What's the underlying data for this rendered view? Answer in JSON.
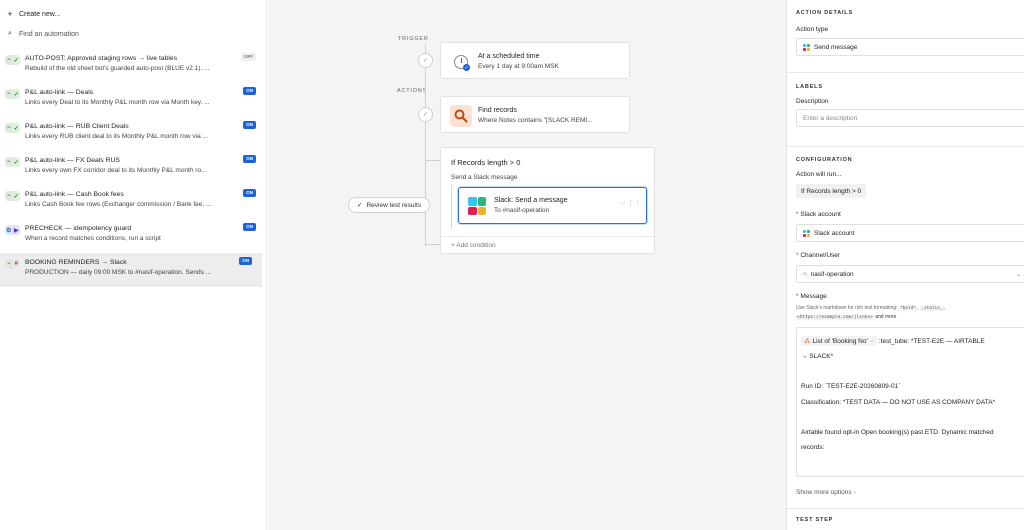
{
  "sidebar": {
    "create_label": "Create new...",
    "search_placeholder": "Find an automation",
    "items": [
      {
        "title": "AUTO-POST: Approved staging rows → live tables",
        "subtitle": "Rebuild of the old sheet bot's guarded auto-post (BLUE v2.1). ...",
        "badge": "OFF",
        "icons": [
          "minus",
          "check"
        ]
      },
      {
        "title": "P&L auto-link — Deals",
        "subtitle": "Links every Deal to its Monthly P&L month row via Month key. ...",
        "badge": "ON",
        "icons": [
          "minus",
          "check"
        ]
      },
      {
        "title": "P&L auto-link — RUB Client Deals",
        "subtitle": "Links every RUB client deal to its Monthly P&L month row via ...",
        "badge": "ON",
        "icons": [
          "minus",
          "check"
        ]
      },
      {
        "title": "P&L auto-link — FX Deals RUS",
        "subtitle": "Links every own FX corridor deal to its Monthly P&L month ro...",
        "badge": "ON",
        "icons": [
          "minus",
          "check"
        ]
      },
      {
        "title": "P&L auto-link — Cash Book fees",
        "subtitle": "Links Cash Book fee rows (Exchanger commission / Bank fee, ...",
        "badge": "ON",
        "icons": [
          "minus",
          "check"
        ]
      },
      {
        "title": "PRECHECK — idempotency guard",
        "subtitle": "When a record matches conditions, run a script",
        "badge": "ON",
        "icons": [
          "tool",
          "play"
        ]
      },
      {
        "title": "BOOKING REMINDERS → Slack",
        "subtitle": "PRODUCTION — daily 09:00 MSK to #nasif-operation. Sends ...",
        "badge": "ON",
        "icons": [
          "minus",
          "slack"
        ]
      }
    ]
  },
  "canvas": {
    "trigger_label": "TRIGGER",
    "actions_label": "ACTIONS",
    "trigger": {
      "title": "At a scheduled time",
      "subtitle": "Every 1 day at 9:00am MSK"
    },
    "find": {
      "title": "Find records",
      "subtitle": "Where Notes contains \"[SLACK REMI..."
    },
    "condition": {
      "title": "If Records length > 0",
      "subtitle": "Send a Slack message",
      "slack_title": "Slack: Send a message",
      "slack_sub": "To #nasif-operation",
      "add_condition": "+ Add condition"
    },
    "review_button": "Review test results"
  },
  "panel": {
    "action_details": "ACTION DETAILS",
    "action_type_label": "Action type",
    "action_type_value": "Send message",
    "labels_section": "LABELS",
    "description_label": "Description",
    "description_placeholder": "Enter a description",
    "configuration_section": "CONFIGURATION",
    "action_will_run_label": "Action will run...",
    "action_will_run_value": "If Records length > 0",
    "slack_account_label": "Slack account",
    "slack_account_value": "Slack account",
    "channel_label": "Channel/User",
    "channel_value": "nasif-operation",
    "message_label": "Message",
    "hint_prefix": "Use Slack's markdown for rich text formatting:",
    "hint_bold": "*bold*",
    "hint_italic": "_italic_",
    "hint_link": "<https://example.com/|links>",
    "hint_more": "and more",
    "message": {
      "token_label": "List of 'Booking No'",
      "line1_rest": ":test_tube: *TEST-E2E — AIRTABLE",
      "line2": "→ SLACK*",
      "line3": "Run ID: `TEST-E2E-20260809-01`",
      "line4": "Classification: *TEST DATA — DO NOT USE AS COMPANY DATA*",
      "line5": "Airtable found opt-in Open booking(s) past ETD. Dynamic matched",
      "line6": "records:"
    },
    "show_more": "Show more options",
    "test_step": "TEST STEP"
  },
  "colors": {
    "badge_on": "#1b63d6",
    "selection_blue": "#2d6fd8",
    "find_icon_bg": "#fbe2d2",
    "slack_green": "#2eb67d",
    "slack_blue": "#36c5f0",
    "slack_red": "#e01e5a",
    "slack_yellow": "#ecb22e"
  }
}
